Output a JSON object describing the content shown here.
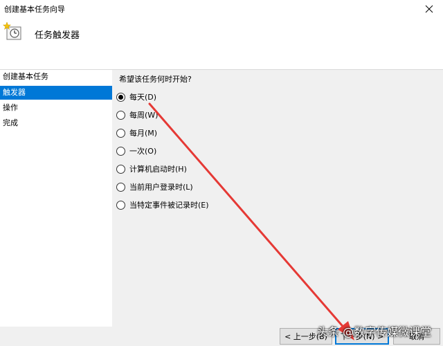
{
  "window": {
    "title": "创建基本任务向导"
  },
  "header": {
    "title": "任务触发器",
    "icon": "clock-task-icon"
  },
  "sidebar": {
    "items": [
      {
        "label": "创建基本任务",
        "active": false
      },
      {
        "label": "触发器",
        "active": true
      },
      {
        "label": "操作",
        "active": false
      },
      {
        "label": "完成",
        "active": false
      }
    ]
  },
  "content": {
    "question": "希望该任务何时开始?",
    "options": [
      {
        "label": "每天(D)",
        "selected": true
      },
      {
        "label": "每周(W)",
        "selected": false
      },
      {
        "label": "每月(M)",
        "selected": false
      },
      {
        "label": "一次(O)",
        "selected": false
      },
      {
        "label": "计算机启动时(H)",
        "selected": false
      },
      {
        "label": "当前用户登录时(L)",
        "selected": false
      },
      {
        "label": "当特定事件被记录时(E)",
        "selected": false
      }
    ]
  },
  "footer": {
    "back_label": "< 上一步(B)",
    "next_label": "下一步(N) >",
    "cancel_label": "取消"
  },
  "watermark": {
    "text": "头条 @数字传媒微课堂"
  },
  "annotation": {
    "color": "#e53935"
  },
  "colors": {
    "accent": "#0078d7",
    "panel": "#f0f0f0"
  }
}
